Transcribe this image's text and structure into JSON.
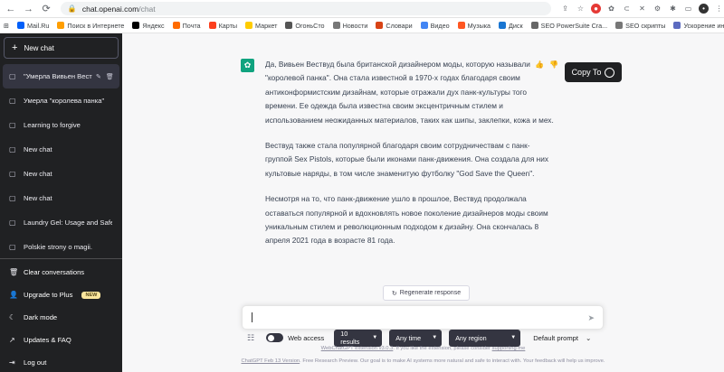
{
  "browser": {
    "url_host": "chat.openai.com",
    "url_path": "/chat",
    "bookmarks": [
      {
        "label": "Mail.Ru",
        "color": "#005ff9"
      },
      {
        "label": "Поиск в Интернете",
        "color": "#ff9e00"
      },
      {
        "label": "Яндекс",
        "color": "#000000"
      },
      {
        "label": "Почта",
        "color": "#ff6b00"
      },
      {
        "label": "Карты",
        "color": "#fc3f1d"
      },
      {
        "label": "Маркет",
        "color": "#ffcc00"
      },
      {
        "label": "ОгоньСто",
        "color": "#555555"
      },
      {
        "label": "Новости",
        "color": "#777777"
      },
      {
        "label": "Словари",
        "color": "#d84315"
      },
      {
        "label": "Видео",
        "color": "#4285f4"
      },
      {
        "label": "Музыка",
        "color": "#ff5722"
      },
      {
        "label": "Диск",
        "color": "#1976d2"
      },
      {
        "label": "SEO PowerSuite Cra...",
        "color": "#666666"
      },
      {
        "label": "SEO скрипты",
        "color": "#777777"
      },
      {
        "label": "Ускорение индекс...",
        "color": "#5c6bc0"
      }
    ]
  },
  "sidebar": {
    "new_chat": "New chat",
    "chats": [
      "\"Умерла Вивьен Вествуд\"",
      "Умерла \"королева панка\"",
      "Learning to forgive",
      "New chat",
      "New chat",
      "New chat",
      "Laundry Gel: Usage and Safety",
      "Polskie strony o magii."
    ],
    "bottom": {
      "clear": "Clear conversations",
      "upgrade": "Upgrade to Plus",
      "upgrade_badge": "NEW",
      "dark": "Dark mode",
      "updates": "Updates & FAQ",
      "logout": "Log out"
    }
  },
  "message": {
    "paragraphs": [
      "Да, Вивьен Вествуд была британской дизайнером моды, которую называли \"королевой панка\". Она стала известной в 1970-х годах благодаря своим антиконформистским дизайнам, которые отражали дух панк-культуры того времени. Ее одежда была известна своим эксцентричным стилем и использованием неожиданных материалов, таких как шипы, заклепки, кожа и мех.",
      "Вествуд также стала популярной благодаря своим сотрудничествам с панк-группой Sex Pistols, которые были иконами панк-движения. Она создала для них культовые наряды, в том числе знаменитую футболку \"God Save the Queen\".",
      "Несмотря на то, что панк-движение ушло в прошлое, Вествуд продолжала оставаться популярной и вдохновлять новое поколение дизайнеров моды своим уникальным стилем и революционным подходом к дизайну. Она скончалась 8 апреля 2021 года в возрасте 81 года."
    ],
    "copy_label": "Copy To"
  },
  "composer": {
    "regenerate": "Regenerate response",
    "input_value": "",
    "web_access": "Web access",
    "results": "10 results",
    "time": "Any time",
    "region": "Any region",
    "prompt": "Default prompt"
  },
  "footer": {
    "line1_link": "WebChatGPT extension v3.0.3",
    "line1_text": ". If you like the extension, please consider ",
    "line1_support": "supporting me",
    "line2_link": "ChatGPT Feb 13 Version",
    "line2_text": ". Free Research Preview. Our goal is to make AI systems more natural and safe to interact with. Your feedback will help us improve."
  }
}
